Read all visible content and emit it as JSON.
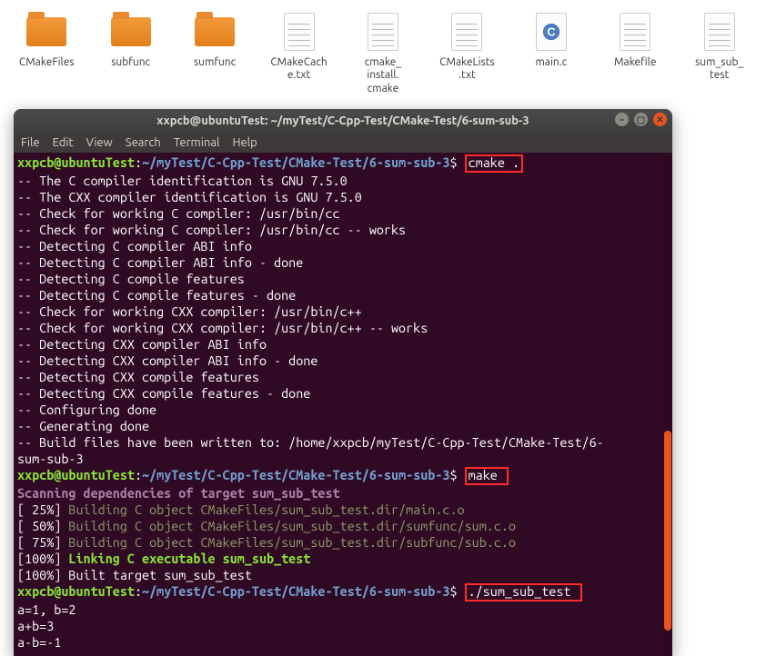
{
  "files": [
    {
      "type": "folder",
      "label": "CMakeFiles"
    },
    {
      "type": "folder",
      "label": "subfunc"
    },
    {
      "type": "folder",
      "label": "sumfunc"
    },
    {
      "type": "text",
      "label": "CMakeCach\ne.txt"
    },
    {
      "type": "text",
      "label": "cmake_\ninstall.\ncmake"
    },
    {
      "type": "text",
      "label": "CMakeLists\n.txt"
    },
    {
      "type": "c",
      "label": "main.c"
    },
    {
      "type": "text",
      "label": "Makefile"
    },
    {
      "type": "text",
      "label": "sum_sub_\ntest"
    }
  ],
  "titlebar": "xxpcb@ubuntuTest: ~/myTest/C-Cpp-Test/CMake-Test/6-sum-sub-3",
  "menu": [
    "File",
    "Edit",
    "View",
    "Search",
    "Terminal",
    "Help"
  ],
  "prompt": {
    "user": "xxpcb@ubuntuTest",
    "sep": ":",
    "path": "~/myTest/C-Cpp-Test/CMake-Test/6-sum-sub-3",
    "sym": "$"
  },
  "cmd1": "cmake .",
  "cmake_out": [
    "-- The C compiler identification is GNU 7.5.0",
    "-- The CXX compiler identification is GNU 7.5.0",
    "-- Check for working C compiler: /usr/bin/cc",
    "-- Check for working C compiler: /usr/bin/cc -- works",
    "-- Detecting C compiler ABI info",
    "-- Detecting C compiler ABI info - done",
    "-- Detecting C compile features",
    "-- Detecting C compile features - done",
    "-- Check for working CXX compiler: /usr/bin/c++",
    "-- Check for working CXX compiler: /usr/bin/c++ -- works",
    "-- Detecting CXX compiler ABI info",
    "-- Detecting CXX compiler ABI info - done",
    "-- Detecting CXX compile features",
    "-- Detecting CXX compile features - done",
    "-- Configuring done",
    "-- Generating done",
    "-- Build files have been written to: /home/xxpcb/myTest/C-Cpp-Test/CMake-Test/6-",
    "sum-sub-3"
  ],
  "cmd2": "make",
  "scan": "Scanning dependencies of target sum_sub_test",
  "build": [
    {
      "pct": "[ 25%] ",
      "txt": "Building C object CMakeFiles/sum_sub_test.dir/main.c.o"
    },
    {
      "pct": "[ 50%] ",
      "txt": "Building C object CMakeFiles/sum_sub_test.dir/sumfunc/sum.c.o"
    },
    {
      "pct": "[ 75%] ",
      "txt": "Building C object CMakeFiles/sum_sub_test.dir/subfunc/sub.c.o"
    }
  ],
  "link_pct": "[100%] ",
  "link_txt": "Linking C executable sum_sub_test",
  "built": "[100%] Built target sum_sub_test",
  "cmd3": "./sum_sub_test",
  "runout": [
    "a=1, b=2",
    "a+b=3",
    "a-b=-1"
  ]
}
